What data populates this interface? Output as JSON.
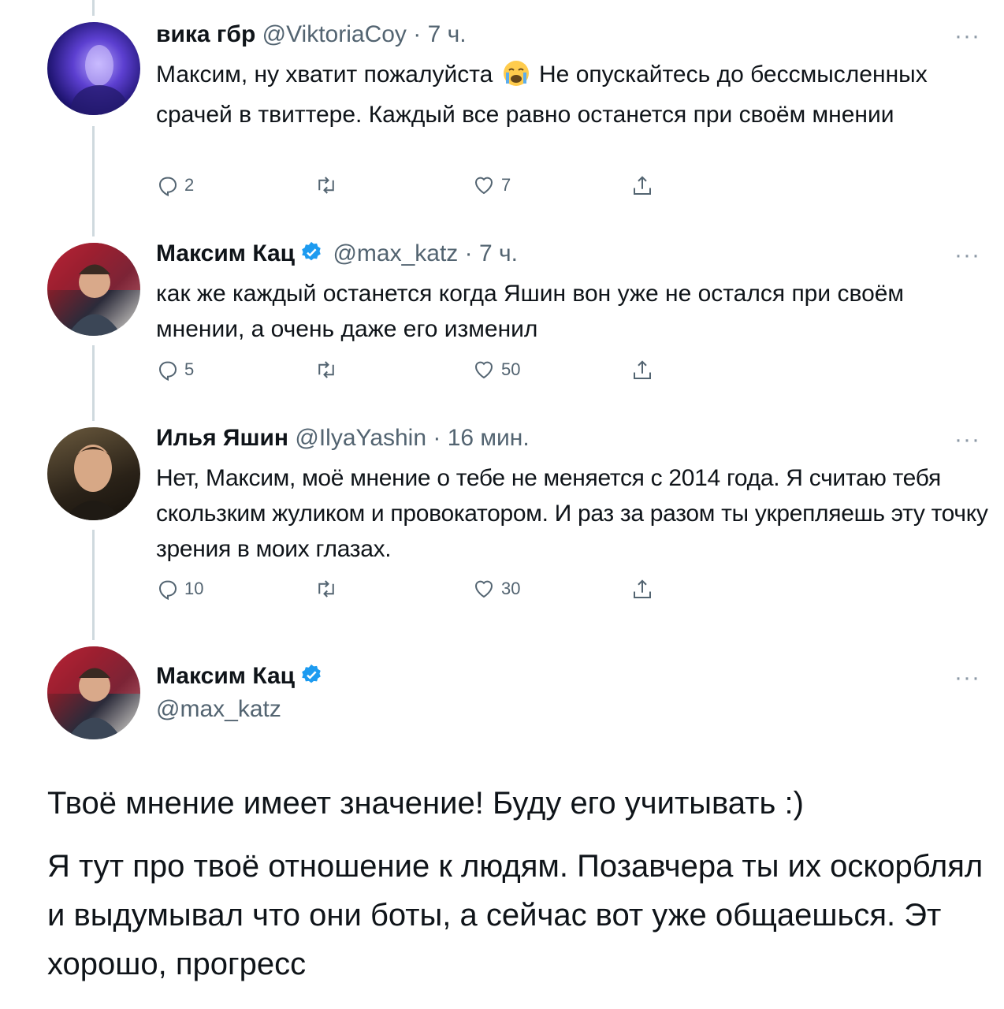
{
  "tweets": [
    {
      "name": "вика гбр",
      "handle": "@ViktoriaCoy",
      "time": "· 7 ч.",
      "text_before_emoji": "Максим, ну хватит пожалуйста ",
      "emoji": "loudly-crying-face",
      "text_after_emoji": " Не опускайтесь до бессмысленных срачей в твиттере. Каждый все равно останется при своём мнении",
      "replies": "2",
      "retweets": "",
      "likes": "7"
    },
    {
      "name": "Максим Кац",
      "handle": "@max_katz",
      "time": "· 7 ч.",
      "text": "как же каждый останется когда Яшин вон уже не остался при своём мнении, а очень даже его изменил",
      "replies": "5",
      "retweets": "",
      "likes": "50"
    },
    {
      "name": "Илья Яшин",
      "handle": "@IlyaYashin",
      "time": "· 16 мин.",
      "text": "Нет, Максим, моё мнение о тебе не меняется с 2014 года. Я считаю тебя скользким жуликом и провокатором. И раз за разом ты укрепляешь эту точку зрения в моих глазах.",
      "replies": "10",
      "retweets": "",
      "likes": "30"
    }
  ],
  "main_tweet": {
    "name": "Максим Кац",
    "handle": "@max_katz",
    "paragraph1": "Твоё мнение имеет значение! Буду его учитывать :)",
    "paragraph2": "Я тут про твоё отношение к людям. Позавчера ты их оскорблял и выдумывал что они боты, а сейчас вот уже общаешься. Эт хорошо, прогресс"
  },
  "more_label": "···",
  "colors": {
    "verified": "#1d9bf0",
    "secondary_text": "#536471",
    "thread_line": "#cfd9de"
  }
}
